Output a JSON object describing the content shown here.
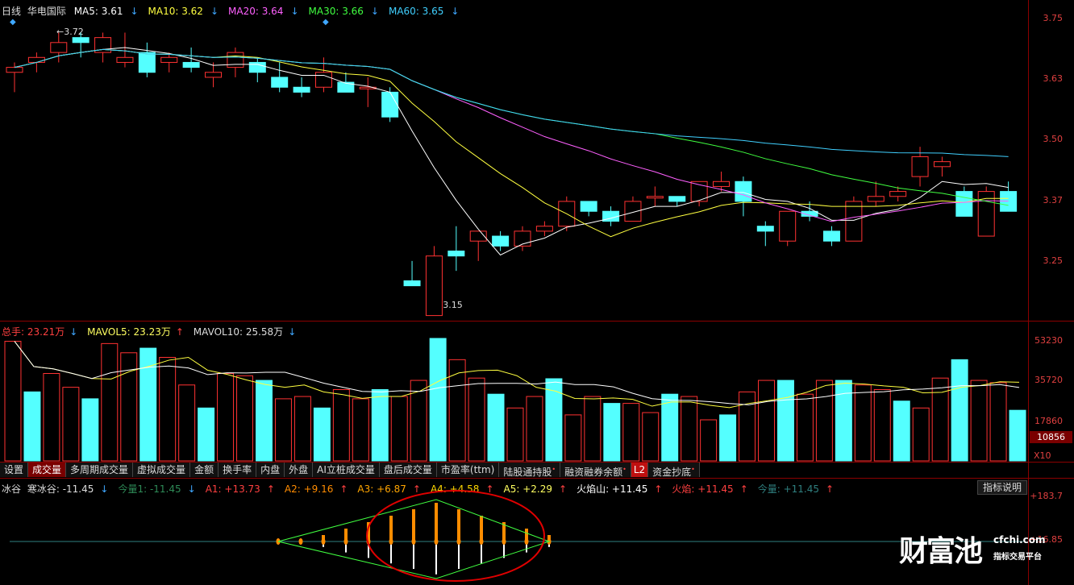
{
  "header": {
    "period": "日线",
    "stock_name": "华电国际",
    "ma": [
      {
        "label": "MA5: 3.61",
        "arrow": "↓",
        "color": "#ffffff"
      },
      {
        "label": "MA10: 3.62",
        "arrow": "↓",
        "color": "#ffff40"
      },
      {
        "label": "MA20: 3.64",
        "arrow": "↓",
        "color": "#ff60ff"
      },
      {
        "label": "MA30: 3.66",
        "arrow": "↓",
        "color": "#40ff40"
      },
      {
        "label": "MA60: 3.65",
        "arrow": "↓",
        "color": "#40d0ff"
      }
    ]
  },
  "price_axis": [
    "3.75",
    "3.63",
    "3.50",
    "3.37",
    "3.25"
  ],
  "price_annotations": {
    "high": "3.72",
    "low": "3.15"
  },
  "volume_header": {
    "total_label": "总手: 23.21万",
    "total_arrow": "↓",
    "mavol5": "MAVOL5: 23.23万",
    "mavol5_arrow": "↑",
    "mavol10": "MAVOL10: 25.58万",
    "mavol10_arrow": "↓"
  },
  "volume_axis": [
    "53230",
    "35720",
    "17860"
  ],
  "volume_current": "10856",
  "volume_unit": "X10",
  "tabs": [
    "设置",
    "成交量",
    "多周期成交量",
    "虚拟成交量",
    "金额",
    "换手率",
    "内盘",
    "外盘",
    "AI立桩成交量",
    "盘后成交量",
    "市盈率(ttm)",
    "陆股通持股",
    "融资融券余额",
    "L2",
    "资金抄底"
  ],
  "tab_active": "成交量",
  "indicator_header": {
    "name": "冰谷",
    "items": [
      {
        "label": "寒冰谷: -11.45",
        "arrow": "↓",
        "color": "#dddddd"
      },
      {
        "label": "今量1: -11.45",
        "arrow": "↓",
        "color": "#2e8b57"
      },
      {
        "label": "A1: +13.73",
        "arrow": "↑",
        "color": "#ff4040"
      },
      {
        "label": "A2: +9.16",
        "arrow": "↑",
        "color": "#ff8c00"
      },
      {
        "label": "A3: +6.87",
        "arrow": "↑",
        "color": "#ffa500"
      },
      {
        "label": "A4: +4.58",
        "arrow": "↑",
        "color": "#ffd700"
      },
      {
        "label": "A5: +2.29",
        "arrow": "↑",
        "color": "#ffff60"
      },
      {
        "label": "火焰山: +11.45",
        "arrow": "↑",
        "color": "#ffffff"
      },
      {
        "label": "火焰: +11.45",
        "arrow": "↑",
        "color": "#ff4040"
      },
      {
        "label": "今量: +11.45",
        "arrow": "↑",
        "color": "#2f8080"
      }
    ]
  },
  "indicator_axis": [
    "+183.7",
    "+16.85"
  ],
  "explain_button": "指标说明",
  "watermark": {
    "main": "财富池",
    "domain": "cfchi.com",
    "sub": "指标交易平台"
  },
  "chart_data": {
    "type": "candlestick",
    "candles": [
      [
        3.64,
        3.66,
        3.6,
        3.65
      ],
      [
        3.66,
        3.68,
        3.64,
        3.67
      ],
      [
        3.68,
        3.72,
        3.66,
        3.7
      ],
      [
        3.71,
        3.72,
        3.67,
        3.7
      ],
      [
        3.68,
        3.72,
        3.66,
        3.71
      ],
      [
        3.66,
        3.72,
        3.65,
        3.67
      ],
      [
        3.68,
        3.7,
        3.63,
        3.64
      ],
      [
        3.66,
        3.68,
        3.64,
        3.67
      ],
      [
        3.66,
        3.69,
        3.64,
        3.65
      ],
      [
        3.63,
        3.66,
        3.61,
        3.64
      ],
      [
        3.65,
        3.69,
        3.63,
        3.68
      ],
      [
        3.66,
        3.67,
        3.62,
        3.64
      ],
      [
        3.63,
        3.66,
        3.6,
        3.61
      ],
      [
        3.61,
        3.63,
        3.59,
        3.6
      ],
      [
        3.61,
        3.67,
        3.6,
        3.64
      ],
      [
        3.62,
        3.64,
        3.6,
        3.6
      ],
      [
        3.61,
        3.63,
        3.57,
        3.61
      ],
      [
        3.6,
        3.61,
        3.54,
        3.55
      ],
      [
        3.22,
        3.26,
        3.21,
        3.21
      ],
      [
        3.15,
        3.29,
        3.15,
        3.27
      ],
      [
        3.28,
        3.33,
        3.24,
        3.27
      ],
      [
        3.3,
        3.31,
        3.26,
        3.32
      ],
      [
        3.31,
        3.32,
        3.28,
        3.29
      ],
      [
        3.29,
        3.33,
        3.28,
        3.32
      ],
      [
        3.32,
        3.34,
        3.31,
        3.33
      ],
      [
        3.33,
        3.39,
        3.32,
        3.38
      ],
      [
        3.38,
        3.38,
        3.35,
        3.36
      ],
      [
        3.36,
        3.37,
        3.33,
        3.34
      ],
      [
        3.34,
        3.39,
        3.34,
        3.38
      ],
      [
        3.39,
        3.41,
        3.37,
        3.39
      ],
      [
        3.39,
        3.38,
        3.37,
        3.38
      ],
      [
        3.38,
        3.42,
        3.37,
        3.42
      ],
      [
        3.41,
        3.44,
        3.4,
        3.42
      ],
      [
        3.42,
        3.43,
        3.35,
        3.38
      ],
      [
        3.33,
        3.34,
        3.29,
        3.32
      ],
      [
        3.3,
        3.36,
        3.29,
        3.36
      ],
      [
        3.36,
        3.38,
        3.34,
        3.35
      ],
      [
        3.32,
        3.33,
        3.29,
        3.3
      ],
      [
        3.3,
        3.39,
        3.3,
        3.38
      ],
      [
        3.38,
        3.42,
        3.37,
        3.39
      ],
      [
        3.39,
        3.41,
        3.38,
        3.4
      ],
      [
        3.43,
        3.49,
        3.41,
        3.47
      ],
      [
        3.45,
        3.47,
        3.43,
        3.46
      ],
      [
        3.4,
        3.41,
        3.35,
        3.35
      ],
      [
        3.31,
        3.41,
        3.31,
        3.4
      ],
      [
        3.4,
        3.42,
        3.36,
        3.36
      ]
    ],
    "volumes": [
      52000,
      30000,
      38000,
      32000,
      27000,
      51000,
      47000,
      49000,
      45000,
      33000,
      23000,
      38000,
      37000,
      35000,
      27000,
      28000,
      23000,
      31000,
      27000,
      31000,
      28000,
      35000,
      53230,
      44000,
      36000,
      29000,
      23000,
      28000,
      35720,
      20000,
      28000,
      25000,
      25000,
      21000,
      29000,
      28000,
      17860,
      20000,
      30000,
      35000,
      35000,
      29000,
      35000,
      35000,
      33000,
      31000,
      26000,
      23000,
      36000,
      44000,
      35000,
      34000,
      22000
    ]
  }
}
